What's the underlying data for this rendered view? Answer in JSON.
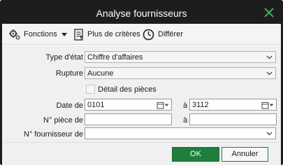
{
  "window": {
    "title": "Analyse fournisseurs"
  },
  "colors": {
    "titlebar": "#1d1d1d",
    "accent": "#1e7e3c",
    "close_icon": "#3fb35f"
  },
  "toolbar": {
    "functions_label": "Fonctions",
    "more_criteria_label": "Plus de critères",
    "defer_label": "Différer"
  },
  "form": {
    "type_etat": {
      "label": "Type d'état",
      "value": "Chiffre d'affaires"
    },
    "rupture": {
      "label": "Rupture",
      "value": "Aucune"
    },
    "detail_pieces": {
      "label": "Détail des pièces",
      "checked": false
    },
    "date": {
      "label": "Date de",
      "from": "0101",
      "to_label": "à",
      "to": "3112"
    },
    "piece": {
      "label": "N° pièce de",
      "from": "",
      "to_label": "à",
      "to": ""
    },
    "fournisseur": {
      "label": "N° fournisseur de",
      "value": ""
    }
  },
  "buttons": {
    "ok": "OK",
    "cancel": "Annuler"
  }
}
